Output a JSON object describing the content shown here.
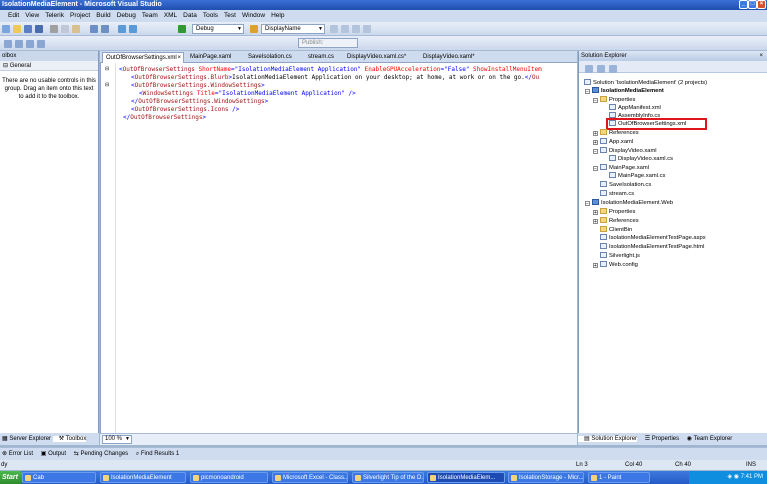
{
  "window": {
    "title": "IsolationMediaElement - Microsoft Visual Studio"
  },
  "menu": [
    "Edit",
    "View",
    "Telerik",
    "Project",
    "Build",
    "Debug",
    "Team",
    "XML",
    "Data",
    "Tools",
    "Test",
    "Window",
    "Help"
  ],
  "toolbar": {
    "config": "Debug",
    "target": "DisplayName",
    "publish": "Publish:"
  },
  "toolbox": {
    "title": "olbox",
    "group": "General",
    "message": "There are no usable controls in this group. Drag an item onto this text to add it to the toolbox.",
    "tabs": [
      "Server Explorer",
      "Toolbox"
    ]
  },
  "editor": {
    "tabs": [
      "OutOfBrowserSettings.xml",
      "MainPage.xaml",
      "SaveIsolation.cs",
      "stream.cs",
      "DisplayVideo.xaml.cs*",
      "DisplayVideo.xaml*"
    ],
    "lines": [
      [
        "<",
        "OutOfBrowserSettings",
        " ShortName",
        "=\"IsolationMediaElement Application\"",
        " EnableGPUAcceleration",
        "=\"False\"",
        " ShowInstallMenuItem"
      ],
      [
        "<",
        "OutOfBrowserSettings.Blurb",
        ">",
        "IsolationMediaElement Application on your desktop; at home, at work or on the go.",
        "</",
        "Ou"
      ],
      [
        "<",
        "OutOfBrowserSettings.WindowSettings",
        ">"
      ],
      [
        "<",
        "WindowSettings",
        " Title",
        "=\"IsolationMediaElement Application\"",
        " />"
      ],
      [
        "</",
        "OutOfBrowserSettings.WindowSettings",
        ">"
      ],
      [
        "<",
        "OutOfBrowserSettings.Icons",
        " />"
      ],
      [
        "</",
        "OutOfBrowserSettings",
        ">"
      ]
    ],
    "zoom": "100 %"
  },
  "solution_explorer": {
    "title": "Solution Explorer",
    "nodes": [
      "Solution 'IsolationMediaElement' (2 projects)",
      "IsolationMediaElement",
      "Properties",
      "AppManifest.xml",
      "AssemblyInfo.cs",
      "OutOfBrowserSettings.xml",
      "References",
      "App.xaml",
      "DisplayVideo.xaml",
      "DisplayVideo.xaml.cs",
      "MainPage.xaml",
      "MainPage.xaml.cs",
      "SaveIsolation.cs",
      "stream.cs",
      "IsolationMediaElement.Web",
      "Properties",
      "References",
      "ClientBin",
      "IsolationMediaElementTestPage.aspx",
      "IsolationMediaElementTestPage.html",
      "Silverlight.js",
      "Web.config"
    ],
    "tabs": [
      "Solution Explorer",
      "Properties",
      "Team Explorer"
    ]
  },
  "bottom_tabs": [
    "Error List",
    "Output",
    "Pending Changes",
    "Find Results 1"
  ],
  "status": {
    "left": "dy",
    "ln": "Ln 3",
    "col": "Col 40",
    "ch": "Ch 40",
    "mode": "INS"
  },
  "taskbar": {
    "start": "Start",
    "tasks": [
      "Cab",
      "IsolationMediaElement",
      "picmonoandroid",
      "Microsoft Excel - Class...",
      "Silverlight Tip of the D...",
      "IsolationMediaElem...",
      "IsolationStorage - Micr...",
      "1 - Paint"
    ],
    "clock": "7:41 PM"
  }
}
